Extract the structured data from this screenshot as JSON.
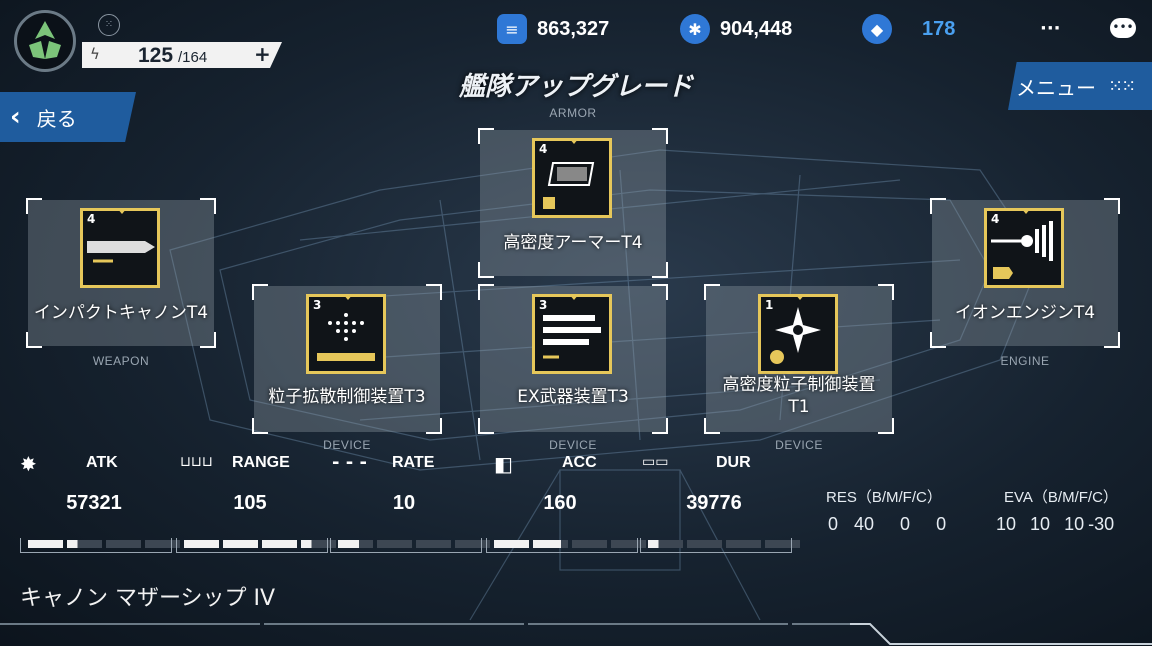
{
  "header": {
    "energy_current": "125",
    "energy_max": "/164",
    "energy_plus": "+",
    "resources": [
      {
        "icon": "list-icon",
        "value": "863,327",
        "color": "#2f78d6"
      },
      {
        "icon": "network-icon",
        "value": "904,448",
        "color": "#2f78d6"
      },
      {
        "icon": "crystal-icon",
        "value": "178",
        "color": "#3b8fe8"
      }
    ],
    "more": "···"
  },
  "title": "艦隊アップグレード",
  "back_label": "戻る",
  "menu_label": "メニュー",
  "cards": {
    "armor": {
      "slot": "ARMOR",
      "tier": "4",
      "name": "高密度アーマーT4"
    },
    "weapon": {
      "slot": "WEAPON",
      "tier": "4",
      "name": "インパクトキャノンT4"
    },
    "engine": {
      "slot": "ENGINE",
      "tier": "4",
      "name": "イオンエンジンT4"
    },
    "device1": {
      "slot": "DEVICE",
      "tier": "3",
      "name": "粒子拡散制御装置T3"
    },
    "device2": {
      "slot": "DEVICE",
      "tier": "3",
      "name": "EX武器装置T3"
    },
    "device3": {
      "slot": "DEVICE",
      "tier": "1",
      "name": "高密度粒子制御装置T1"
    }
  },
  "stats": [
    {
      "name": "ATK",
      "value": "57321",
      "segments": 1.3
    },
    {
      "name": "RANGE",
      "value": "105",
      "segments": 3.3
    },
    {
      "name": "RATE",
      "value": "10",
      "segments": 0.6
    },
    {
      "name": "ACC",
      "value": "160",
      "segments": 1.8
    },
    {
      "name": "DUR",
      "value": "39776",
      "segments": 0.3
    }
  ],
  "resistance": {
    "label": "RES（B/M/F/C）",
    "values": [
      "0",
      "40",
      "0",
      "0"
    ]
  },
  "evasion": {
    "label": "EVA（B/M/F/C）",
    "values": [
      "10",
      "10",
      "10",
      "-30"
    ]
  },
  "ship_name": "キャノン マザーシップ IV"
}
